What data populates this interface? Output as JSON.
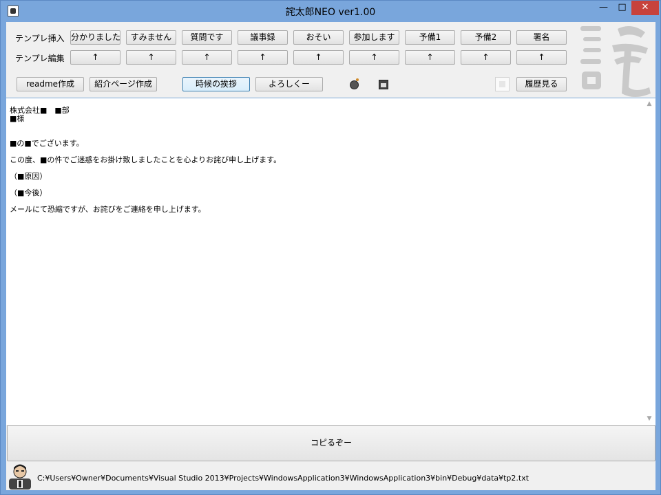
{
  "window": {
    "title": "詫太郎NEO  ver1.00",
    "controls": {
      "minimize": "—",
      "maximize": "□",
      "close": "✕"
    }
  },
  "rows": {
    "insert_label": "テンプレ挿入",
    "edit_label": "テンプレ編集",
    "insert_buttons": [
      "分かりました",
      "すみません",
      "質問です",
      "議事録",
      "おそい",
      "参加します",
      "予備1",
      "予備2",
      "署名"
    ],
    "edit_buttons": [
      "↑",
      "↑",
      "↑",
      "↑",
      "↑",
      "↑",
      "↑",
      "↑",
      "↑"
    ]
  },
  "toolbar": {
    "readme": "readme作成",
    "intro_page": "紹介ページ作成",
    "seasonal_greeting": "時候の挨拶",
    "yoroshiku": "よろしくー",
    "history": "履歴見る"
  },
  "logo_text": "詫",
  "editor": {
    "lines": [
      "株式会社■　■部",
      "■様",
      "",
      "",
      "■の■でございます。",
      "",
      "この度、■の件でご迷惑をお掛け致しましたことを心よりお詫び申し上げます。",
      "",
      "（■原因）",
      "",
      "（■今後）",
      "",
      "メールにて恐縮ですが、お詫びをご連絡を申し上げます。"
    ]
  },
  "copy_button": "コピるぞー",
  "status_path": "C:¥Users¥Owner¥Documents¥Visual Studio 2013¥Projects¥WindowsApplication3¥WindowsApplication3¥bin¥Debug¥data¥tp2.txt",
  "colors": {
    "titlebar": "#79a6dc",
    "close": "#c7423c",
    "client": "#f0f0f0"
  }
}
